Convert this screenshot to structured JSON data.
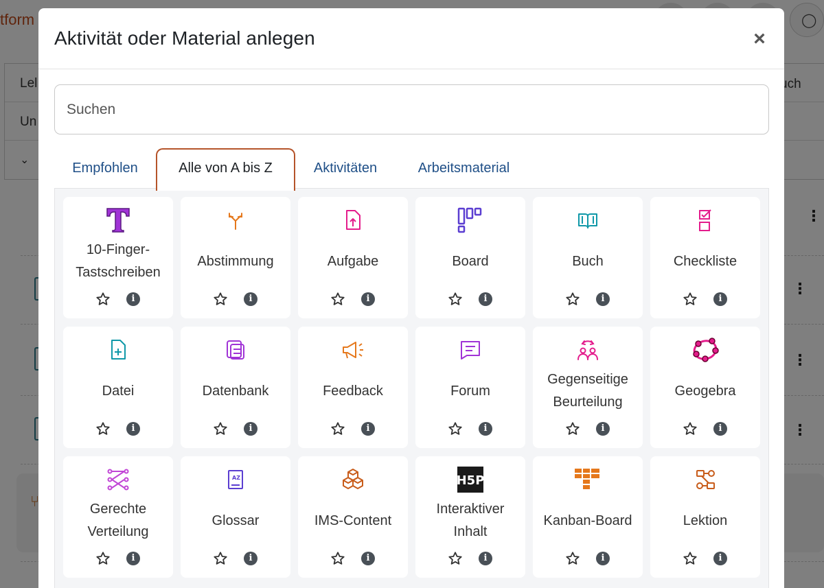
{
  "background": {
    "brand_fragment": "tform",
    "table_rows": [
      "Lel",
      "Un"
    ],
    "right_fragment": "uch"
  },
  "modal": {
    "title": "Aktivität oder Material anlegen",
    "close_glyph": "×",
    "search_placeholder": "Suchen",
    "tabs": [
      "Empfohlen",
      "Alle von A bis Z",
      "Aktivitäten",
      "Arbeitsmaterial"
    ],
    "active_tab": "Alle von A bis Z",
    "info_glyph": "i",
    "h5p_label": "H5P",
    "items": [
      {
        "label": "10-Finger-\nTastschreiben",
        "icon": "typewriter-T-icon",
        "color": "#a033d6"
      },
      {
        "label": "Abstimmung",
        "icon": "choice-split-icon",
        "color": "#e5781c"
      },
      {
        "label": "Aufgabe",
        "icon": "assignment-upload-icon",
        "color": "#e41c8c"
      },
      {
        "label": "Board",
        "icon": "board-columns-icon",
        "color": "#5b3ed1"
      },
      {
        "label": "Buch",
        "icon": "book-icon",
        "color": "#0f98a8"
      },
      {
        "label": "Checkliste",
        "icon": "checklist-icon",
        "color": "#e41c8c"
      },
      {
        "label": "Datei",
        "icon": "file-add-icon",
        "color": "#0f98a8"
      },
      {
        "label": "Datenbank",
        "icon": "database-icon",
        "color": "#a033d6"
      },
      {
        "label": "Feedback",
        "icon": "megaphone-icon",
        "color": "#e5781c"
      },
      {
        "label": "Forum",
        "icon": "forum-chat-icon",
        "color": "#a033d6"
      },
      {
        "label": "Gegenseitige\nBeurteilung",
        "icon": "peer-review-icon",
        "color": "#e41c8c"
      },
      {
        "label": "Geogebra",
        "icon": "geogebra-icon",
        "color": "#e41c8c"
      },
      {
        "label": "Gerechte\nVerteilung",
        "icon": "fair-allocation-icon",
        "color": "#c146d6"
      },
      {
        "label": "Glossar",
        "icon": "glossary-icon",
        "color": "#5b3ed1"
      },
      {
        "label": "IMS-Content",
        "icon": "ims-cubes-icon",
        "color": "#c85c1a"
      },
      {
        "label": "Interaktiver\nInhalt",
        "icon": "h5p-icon",
        "color": "#1a1a1a"
      },
      {
        "label": "Kanban-Board",
        "icon": "kanban-icon",
        "color": "#e5781c"
      },
      {
        "label": "Lektion",
        "icon": "lesson-flow-icon",
        "color": "#c85c1a"
      }
    ]
  }
}
